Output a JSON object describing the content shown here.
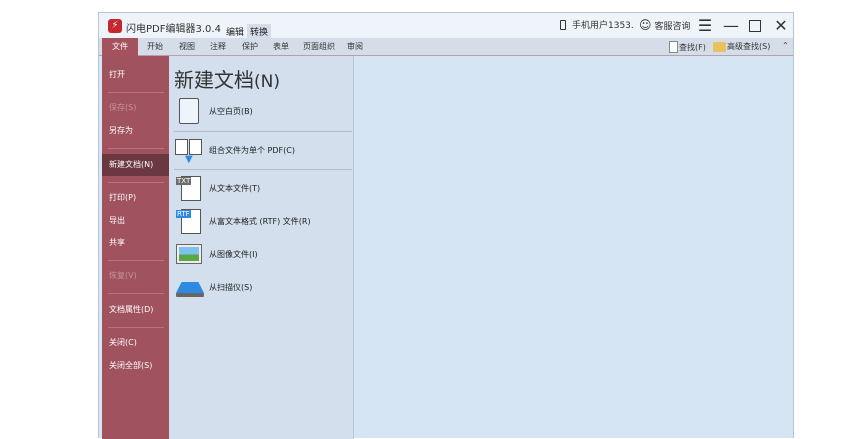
{
  "app": {
    "title": "闪电PDF编辑器3.0.4",
    "modes": [
      "编辑",
      "转换"
    ],
    "user": "手机用户1353.",
    "support": "客服咨询"
  },
  "ribbon": {
    "tabs": [
      "文件",
      "开始",
      "视图",
      "注释",
      "保护",
      "表单",
      "页面组织",
      "审阅"
    ],
    "find": "查找(F)",
    "advanced_find": "高级查找(S)"
  },
  "sidebar": {
    "items": [
      "打开",
      "保存(S)",
      "另存为",
      "新建文档(N)",
      "打印(P)",
      "导出",
      "共享",
      "恢复(V)",
      "文档属性(D)",
      "关闭(C)",
      "关闭全部(S)"
    ]
  },
  "panel": {
    "title": "新建文档",
    "title_key": "(N)",
    "items": [
      "从空白页(B)",
      "组合文件为单个 PDF(C)",
      "从文本文件(T)",
      "从富文本格式 (RTF) 文件(R)",
      "从图像文件(I)",
      "从扫描仪(S)"
    ],
    "icon_txt": "TXT",
    "icon_rtf": "RTF"
  },
  "colors": {
    "sidebar": "#a0525e",
    "selected": "#6b3841",
    "panel": "#d3dfec",
    "content": "#d5e5f3"
  }
}
